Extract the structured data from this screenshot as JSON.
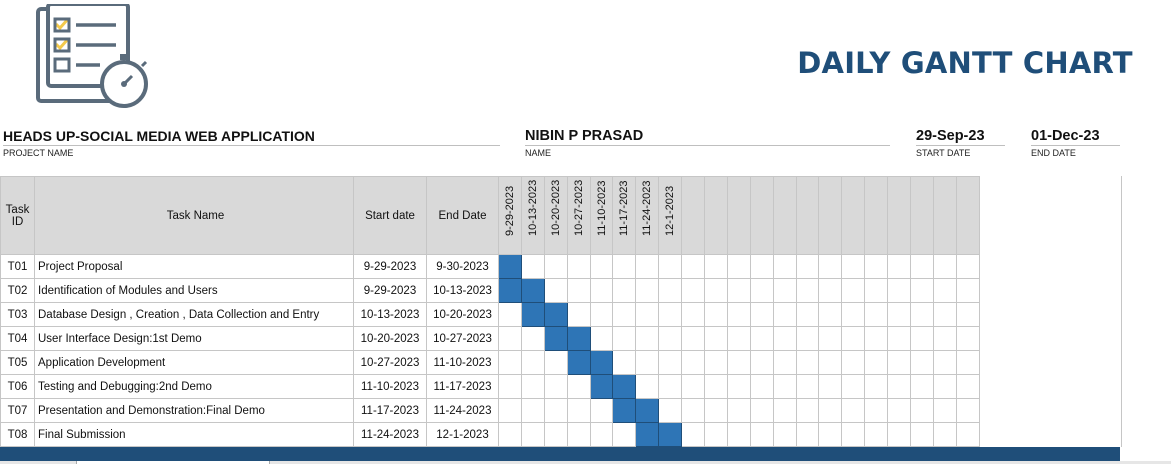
{
  "logo_icon": "checklist-stopwatch-icon",
  "title": "DAILY GANTT CHART",
  "project": {
    "value": "HEADS UP-SOCIAL MEDIA WEB APPLICATION",
    "label": "PROJECT NAME"
  },
  "owner": {
    "value": "NIBIN P PRASAD",
    "label": "NAME"
  },
  "start": {
    "value": "29-Sep-23",
    "label": "START DATE"
  },
  "end": {
    "value": "01-Dec-23",
    "label": "END DATE"
  },
  "headers": {
    "id": "Task ID",
    "name": "Task Name",
    "start": "Start date",
    "end": "End Date"
  },
  "colors": {
    "accent": "#1f4e79",
    "bar": "#2e75b6",
    "header_bg": "#d9d9d9"
  },
  "chart_data": {
    "type": "table",
    "timeline_columns": [
      "9-29-2023",
      "10-13-2023",
      "10-20-2023",
      "10-27-2023",
      "11-10-2023",
      "11-17-2023",
      "11-24-2023",
      "12-1-2023",
      "",
      "",
      "",
      "",
      "",
      "",
      "",
      "",
      "",
      "",
      "",
      "",
      ""
    ],
    "tasks": [
      {
        "id": "T01",
        "name": "Project Proposal",
        "start": "9-29-2023",
        "end": "9-30-2023",
        "span": [
          0,
          0
        ]
      },
      {
        "id": "T02",
        "name": "Identification of Modules and Users",
        "start": "9-29-2023",
        "end": "10-13-2023",
        "span": [
          0,
          1
        ]
      },
      {
        "id": "T03",
        "name": "Database Design , Creation , Data Collection and Entry",
        "start": "10-13-2023",
        "end": "10-20-2023",
        "span": [
          1,
          2
        ]
      },
      {
        "id": "T04",
        "name": "User Interface Design:1st Demo",
        "start": "10-20-2023",
        "end": "10-27-2023",
        "span": [
          2,
          3
        ]
      },
      {
        "id": "T05",
        "name": "Application Development",
        "start": "10-27-2023",
        "end": "11-10-2023",
        "span": [
          3,
          4
        ]
      },
      {
        "id": "T06",
        "name": "Testing and Debugging:2nd Demo",
        "start": "11-10-2023",
        "end": "11-17-2023",
        "span": [
          4,
          5
        ]
      },
      {
        "id": "T07",
        "name": "Presentation and Demonstration:Final Demo",
        "start": "11-17-2023",
        "end": "11-24-2023",
        "span": [
          5,
          6
        ]
      },
      {
        "id": "T08",
        "name": "Final Submission",
        "start": "11-24-2023",
        "end": "12-1-2023",
        "span": [
          6,
          7
        ]
      }
    ]
  }
}
